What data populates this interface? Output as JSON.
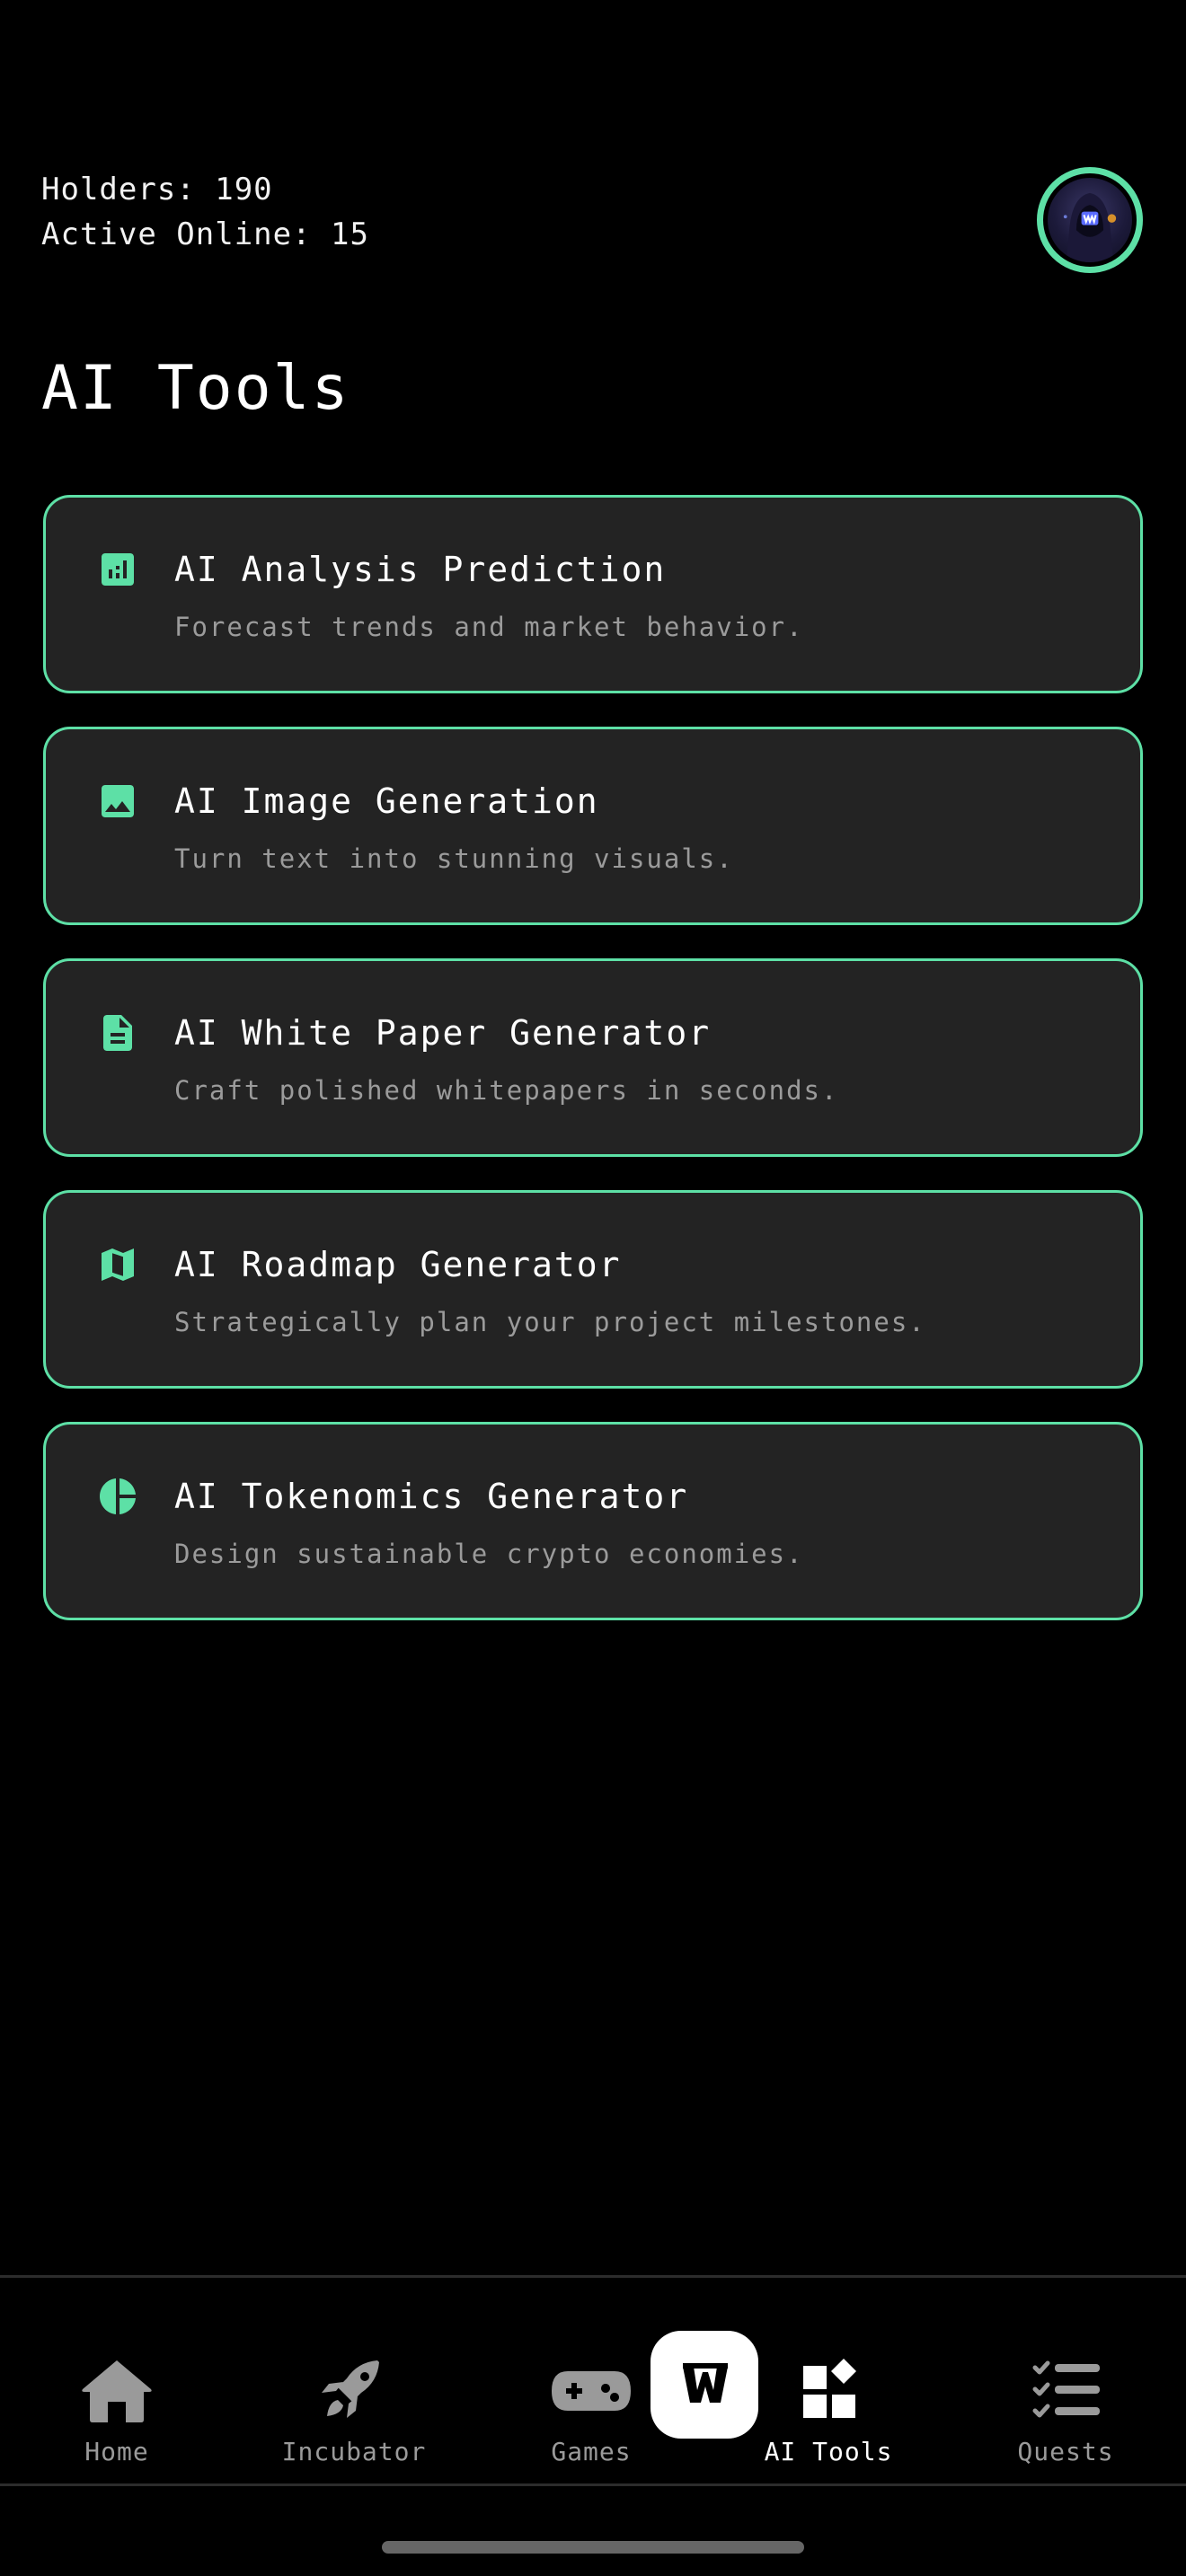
{
  "header": {
    "holders_label": "Holders: 190",
    "active_label": "Active Online: 15"
  },
  "page": {
    "title": "AI Tools"
  },
  "accent_color": "#5de0a6",
  "tools": [
    {
      "icon": "bar-chart-icon",
      "title": "AI Analysis Prediction",
      "description": "Forecast trends and market behavior."
    },
    {
      "icon": "image-icon",
      "title": "AI Image Generation",
      "description": "Turn text into stunning visuals."
    },
    {
      "icon": "document-icon",
      "title": "AI White Paper Generator",
      "description": "Craft polished whitepapers in seconds."
    },
    {
      "icon": "map-icon",
      "title": "AI Roadmap Generator",
      "description": "Strategically plan your project milestones."
    },
    {
      "icon": "pie-chart-icon",
      "title": "AI Tokenomics Generator",
      "description": "Design sustainable crypto economies."
    }
  ],
  "bottom_nav": {
    "items": [
      {
        "icon": "home-icon",
        "label": "Home"
      },
      {
        "icon": "rocket-icon",
        "label": "Incubator"
      },
      {
        "icon": "gamepad-icon",
        "label": "Games"
      },
      {
        "icon": "widgets-icon",
        "label": "AI Tools",
        "active": true
      },
      {
        "icon": "checklist-icon",
        "label": "Quests"
      }
    ],
    "center_button": {
      "icon": "w-logo-icon",
      "glyph": "W"
    }
  }
}
